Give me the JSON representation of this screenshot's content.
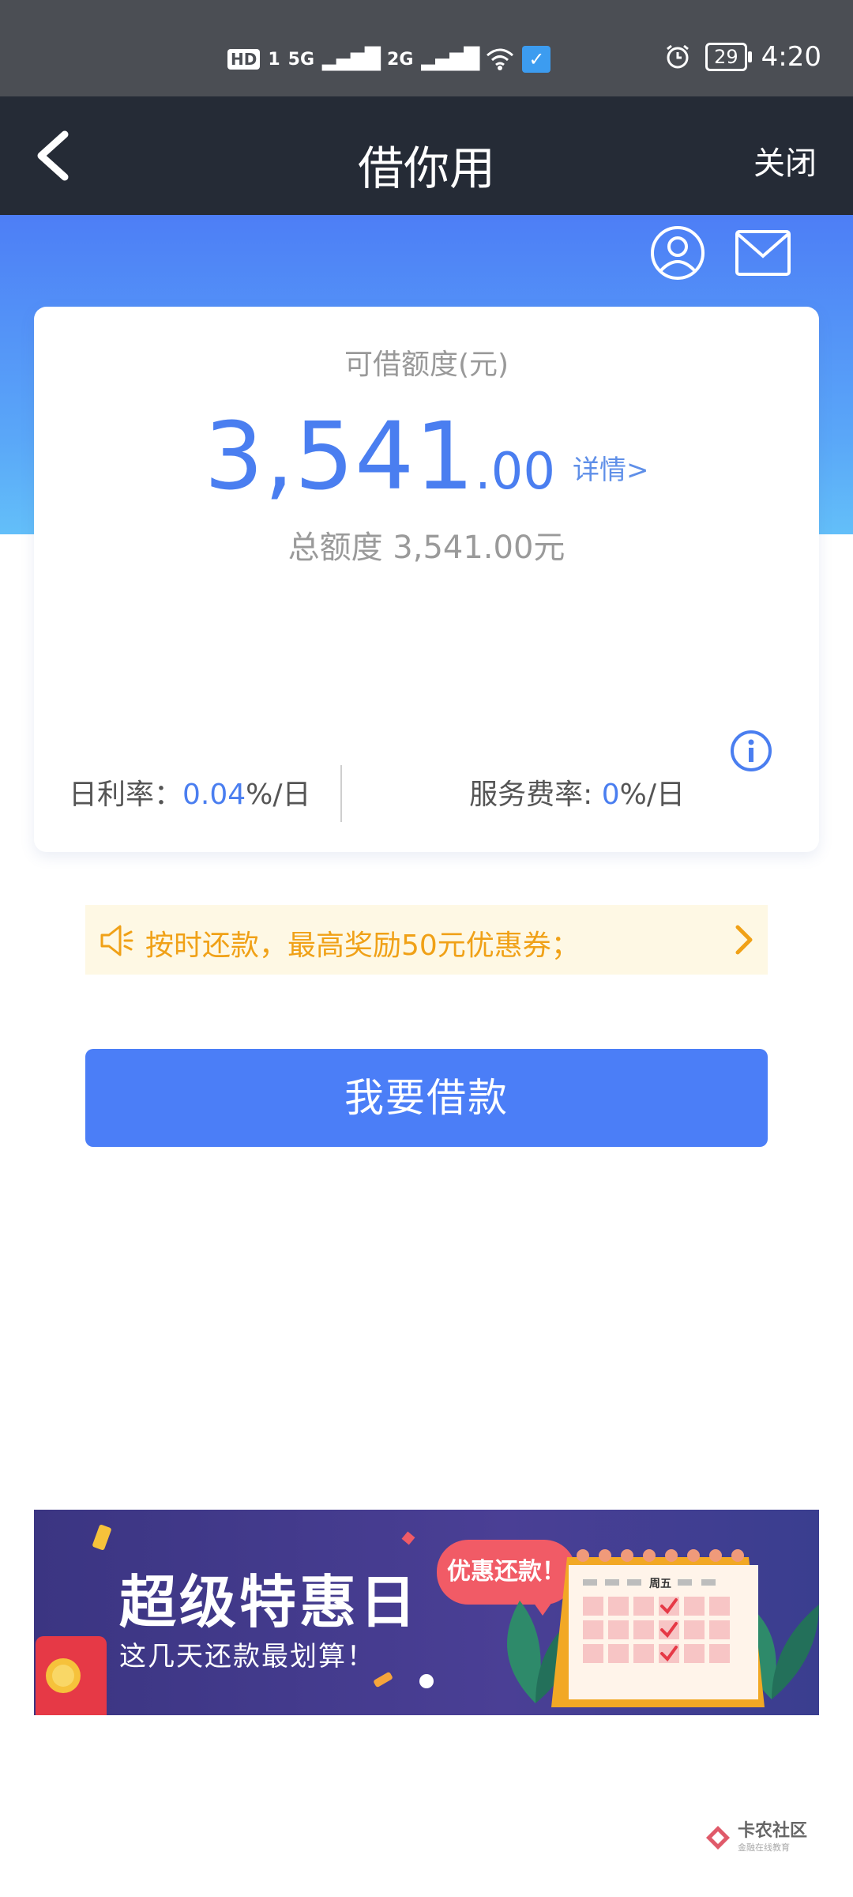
{
  "status_bar": {
    "hd_label": "HD",
    "sim_label": "1",
    "signal1": "5G",
    "signal2": "2G",
    "battery": "29",
    "time": "4:20"
  },
  "nav": {
    "title": "借你用",
    "close_label": "关闭"
  },
  "card": {
    "label": "可借额度(元)",
    "amount_int": "3,541",
    "amount_dec": ".00",
    "detail_link": "详情>",
    "total_prefix": "总额度",
    "total_value": "3,541.00元",
    "daily_rate_label": "日利率：",
    "daily_rate_value": "0.04",
    "daily_rate_unit": "%/日",
    "fee_rate_label": "服务费率: ",
    "fee_rate_value": "0",
    "fee_rate_unit": "%/日"
  },
  "notice": {
    "text": "按时还款，最高奖励50元优惠券；"
  },
  "borrow_button": "我要借款",
  "banner": {
    "title": "超级特惠日",
    "subtitle": "这几天还款最划算！",
    "bubble": "优惠还款！",
    "calendar_day": "周五"
  },
  "watermark": {
    "main": "卡农社区",
    "sub": "金融在线教育"
  },
  "colors": {
    "accent": "#4b7ef7",
    "nav_bg": "#252b36",
    "notice_text": "#f0a117"
  }
}
